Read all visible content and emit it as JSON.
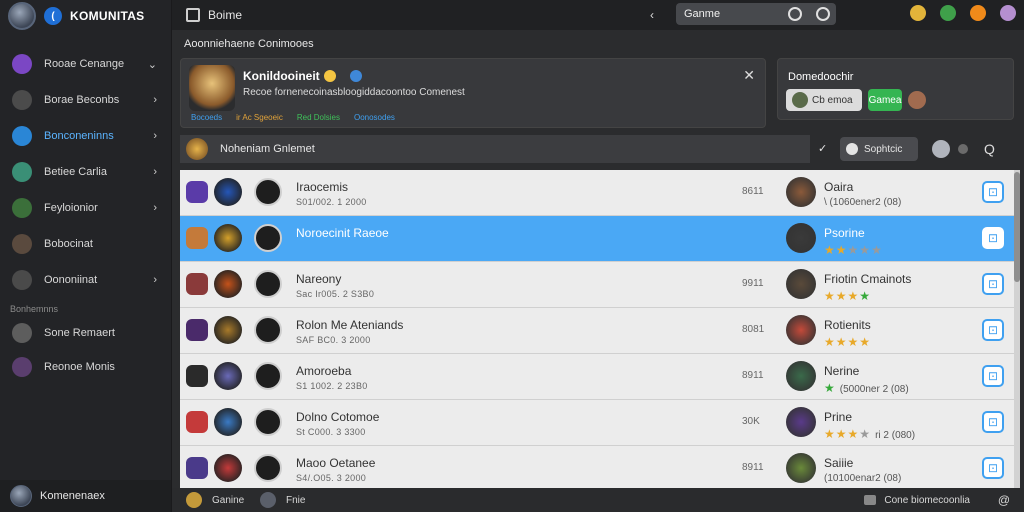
{
  "brand": {
    "name": "KOMUNITAS"
  },
  "sidebar": {
    "items": [
      {
        "label": "Rooae Cenange",
        "color": "#7b47c4"
      },
      {
        "label": "Borae Beconbs",
        "color": "#4b4b4b"
      },
      {
        "label": "Bonconeninns",
        "color": "#2a86d6"
      },
      {
        "label": "Betiee Carlia",
        "color": "#3a8f76"
      },
      {
        "label": "Feyloionior",
        "color": "#3b6f3a"
      },
      {
        "label": "Bobocinat",
        "color": "#5a4a3e"
      },
      {
        "label": "Oononiinat",
        "color": "#4a4a4a"
      }
    ],
    "section_label": "Bonhemnns",
    "section_items": [
      {
        "label": "Sone Remaert",
        "color": "#5d5d5d"
      },
      {
        "label": "Reonoe Monis",
        "color": "#5a3e6e"
      }
    ],
    "footer_label": "Komenenaex"
  },
  "topbar": {
    "home_label": "Boime",
    "back_glyph": "‹",
    "search_value": "Ganme"
  },
  "section_title": "Aoonniehaene Conimooes",
  "featured": {
    "title": "Konildooineit",
    "desc": "Recoe fornenecoinasbloogiddacoontoo Comenest",
    "tags": [
      {
        "label": "Bocoeds",
        "color": "#3fa0f0"
      },
      {
        "label": "ir Ac Sgeoeic",
        "color": "#e0a23a"
      },
      {
        "label": "Red Dolsies",
        "color": "#3fc05a"
      },
      {
        "label": "Oonosodes",
        "color": "#3fa0f0"
      }
    ],
    "close_glyph": "✕"
  },
  "side_card": {
    "title": "Domedoochir",
    "pill_a": "Cb emoa",
    "pill_b": "Gamea"
  },
  "filter": {
    "label": "Noheniam Gnlemet",
    "check": "✓",
    "button": "Sophtcic",
    "q_glyph": "Q"
  },
  "rows": [
    {
      "name": "Iraocemis",
      "sub": "S01/002. 1 2000",
      "num": "8611",
      "rname": "Oaira",
      "rsub": "\\ (1060ener2 (08)",
      "stars": null,
      "selected": false,
      "c1": "#5a3ba8",
      "c2": "#2456b8",
      "c4": "#8b5a3a"
    },
    {
      "name": "Noroecinit Raeoe",
      "sub": "",
      "num": "",
      "rname": "Psorine",
      "rsub": "",
      "stars": [
        "s",
        "s",
        "e",
        "e",
        "e"
      ],
      "selected": true,
      "c1": "#c47a3a",
      "c2": "#d4a02a",
      "c4": "#3a3a3a"
    },
    {
      "name": "Nareony",
      "sub": "Sac Ir005. 2 S3B0",
      "num": "9911",
      "rname": "Friotin Cmainots",
      "rsub": "",
      "stars": [
        "s",
        "s",
        "s",
        "g"
      ],
      "selected": false,
      "c1": "#8a3a3a",
      "c2": "#c4521a",
      "c4": "#5a4a3a"
    },
    {
      "name": "Rolon Me Ateniands",
      "sub": "SAF BC0. 3 2000",
      "num": "8081",
      "rname": "Rotienits",
      "rsub": "",
      "stars": [
        "s",
        "s",
        "s",
        "s"
      ],
      "selected": false,
      "c1": "#4a2a6a",
      "c2": "#a87a2a",
      "c4": "#c44a3a"
    },
    {
      "name": "Amoroeba",
      "sub": "S1 1002. 2 23B0",
      "num": "8911",
      "rname": "Nerine",
      "rsub": "(5000ner 2 (08)",
      "stars": [
        "g"
      ],
      "selected": false,
      "c1": "#2a2a2a",
      "c2": "#6a6ab8",
      "c4": "#3a6a4a"
    },
    {
      "name": "Dolno Cotomoe",
      "sub": "St C000. 3 3300",
      "num": "30K",
      "rname": "Prine",
      "rsub": "ri 2 (080)",
      "stars": [
        "s",
        "s",
        "s",
        "e"
      ],
      "selected": false,
      "c1": "#c43a3a",
      "c2": "#3a7ac4",
      "c4": "#5a3a8a"
    },
    {
      "name": "Maoo Oetanee",
      "sub": "S4/.O05. 3 2000",
      "num": "8911",
      "rname": "Saiiie",
      "rsub": "(10100enar2 (08)",
      "stars": null,
      "selected": false,
      "c1": "#4a3a8a",
      "c2": "#c43a3a",
      "c4": "#6a8a3a"
    }
  ],
  "statusbar": {
    "left_label": "Ganine",
    "mid_label": "Fnie",
    "right_label": "Cone biomecoonlia",
    "end_glyph": "@"
  }
}
